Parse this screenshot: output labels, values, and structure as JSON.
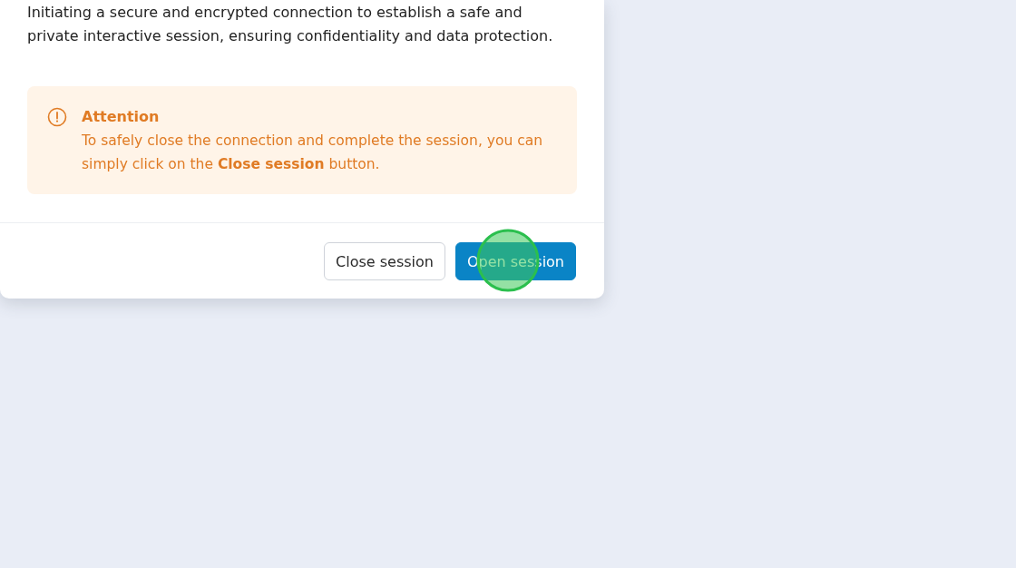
{
  "dialog": {
    "description": "Initiating a secure and encrypted connection to establish a safe and private interactive session, ensuring confidentiality and data protection.",
    "alert": {
      "kind": "warning",
      "title": "Attention",
      "message": "To safely close the connection and complete the session, you can simply click on the **Close session** button."
    },
    "buttons": [
      {
        "label": "Close session",
        "kind": "secondary"
      },
      {
        "label": "Open session",
        "kind": "primary"
      }
    ]
  }
}
